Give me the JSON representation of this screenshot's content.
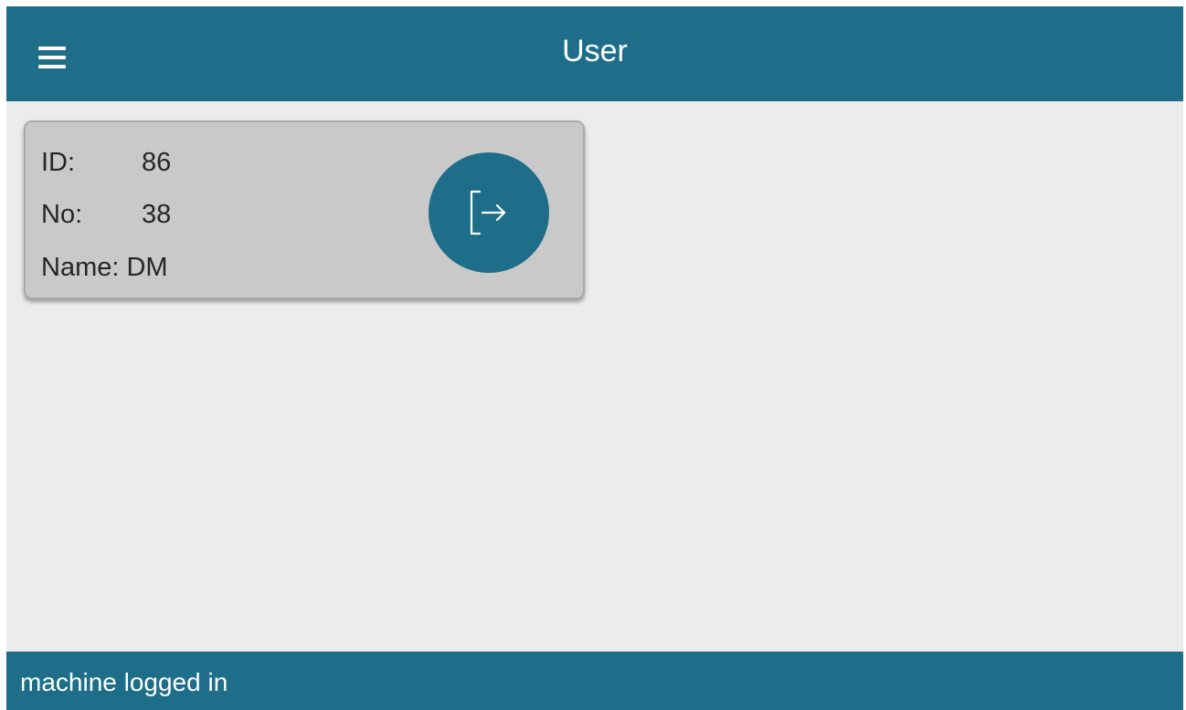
{
  "app_bar": {
    "title": "User",
    "menu_icon": "hamburger-menu-icon",
    "background_color": "#1e6e8a"
  },
  "user_card": {
    "fields": [
      {
        "label": "ID:",
        "value": "86"
      },
      {
        "label": "No:",
        "value": "38"
      },
      {
        "label": "Name:",
        "value": "DM"
      }
    ],
    "logout_icon": "logout-icon",
    "card_color": "#c9c9c9"
  },
  "status_bar": {
    "text": "machine logged in"
  },
  "colors": {
    "accent": "#1e6e8a",
    "background": "#ececec"
  }
}
